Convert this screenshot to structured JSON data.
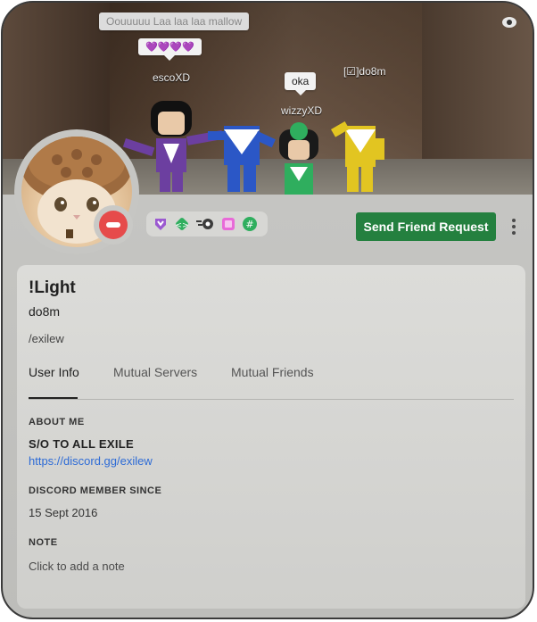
{
  "banner": {
    "chat_bubbles": [
      {
        "text": "Oouuuuu Laa laa laa mallow"
      },
      {
        "text": "💜💜💜💜"
      },
      {
        "text": "oka"
      }
    ],
    "player_names": [
      "escoXD",
      "wizzyXD",
      "[☑]do8m"
    ]
  },
  "profile": {
    "display_name": "!Light",
    "username": "do8m",
    "custom_status": "/exilew",
    "status": "do-not-disturb"
  },
  "badges": [
    {
      "name": "hypesquad-icon",
      "color": "#9b59d0"
    },
    {
      "name": "developer-icon",
      "color": "#2fae5e"
    },
    {
      "name": "speed-icon",
      "color": "#3b3b3b"
    },
    {
      "name": "nitro-book-icon",
      "color": "#e86ad8"
    },
    {
      "name": "hash-icon",
      "color": "#2fae5e"
    }
  ],
  "actions": {
    "send_friend_request": "Send Friend Request"
  },
  "tabs": [
    {
      "label": "User Info",
      "active": true
    },
    {
      "label": "Mutual Servers",
      "active": false
    },
    {
      "label": "Mutual Friends",
      "active": false
    }
  ],
  "about_me": {
    "heading": "ABOUT ME",
    "line": "S/O TO ALL EXILE",
    "link": "https://discord.gg/exilew"
  },
  "member_since": {
    "heading": "DISCORD MEMBER SINCE",
    "value": "15 Sept 2016"
  },
  "note": {
    "heading": "NOTE",
    "placeholder": "Click to add a note"
  },
  "colors": {
    "accent_green": "#24803f",
    "link_blue": "#2d6bd6",
    "dnd_red": "#e64b4b"
  }
}
